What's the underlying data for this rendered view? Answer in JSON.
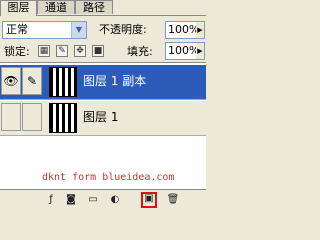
{
  "tabs": [
    {
      "label": "图层"
    },
    {
      "label": "通道"
    },
    {
      "label": "路径"
    }
  ],
  "blend_mode": {
    "value": "正常"
  },
  "opacity": {
    "label": "不透明度:",
    "value": "100%"
  },
  "lock": {
    "label": "锁定:"
  },
  "fill": {
    "label": "填充:",
    "value": "100%"
  },
  "layers": [
    {
      "name": "图层 1 副本",
      "selected": true
    },
    {
      "name": "图层 1",
      "selected": false
    }
  ],
  "watermark": "dknt form blueidea.com",
  "icons": {
    "eye": "eye-icon",
    "brush": "brush-icon",
    "link": "link-icon",
    "fx": "fx-icon",
    "mask": "layer-mask-icon",
    "group": "folder-icon",
    "adjust": "adjustment-layer-icon",
    "new": "new-layer-icon",
    "delete": "trash-icon"
  },
  "colors": {
    "selection": "#2b5cba",
    "highlight_box": "#e01010",
    "watermark": "#c0392b"
  }
}
